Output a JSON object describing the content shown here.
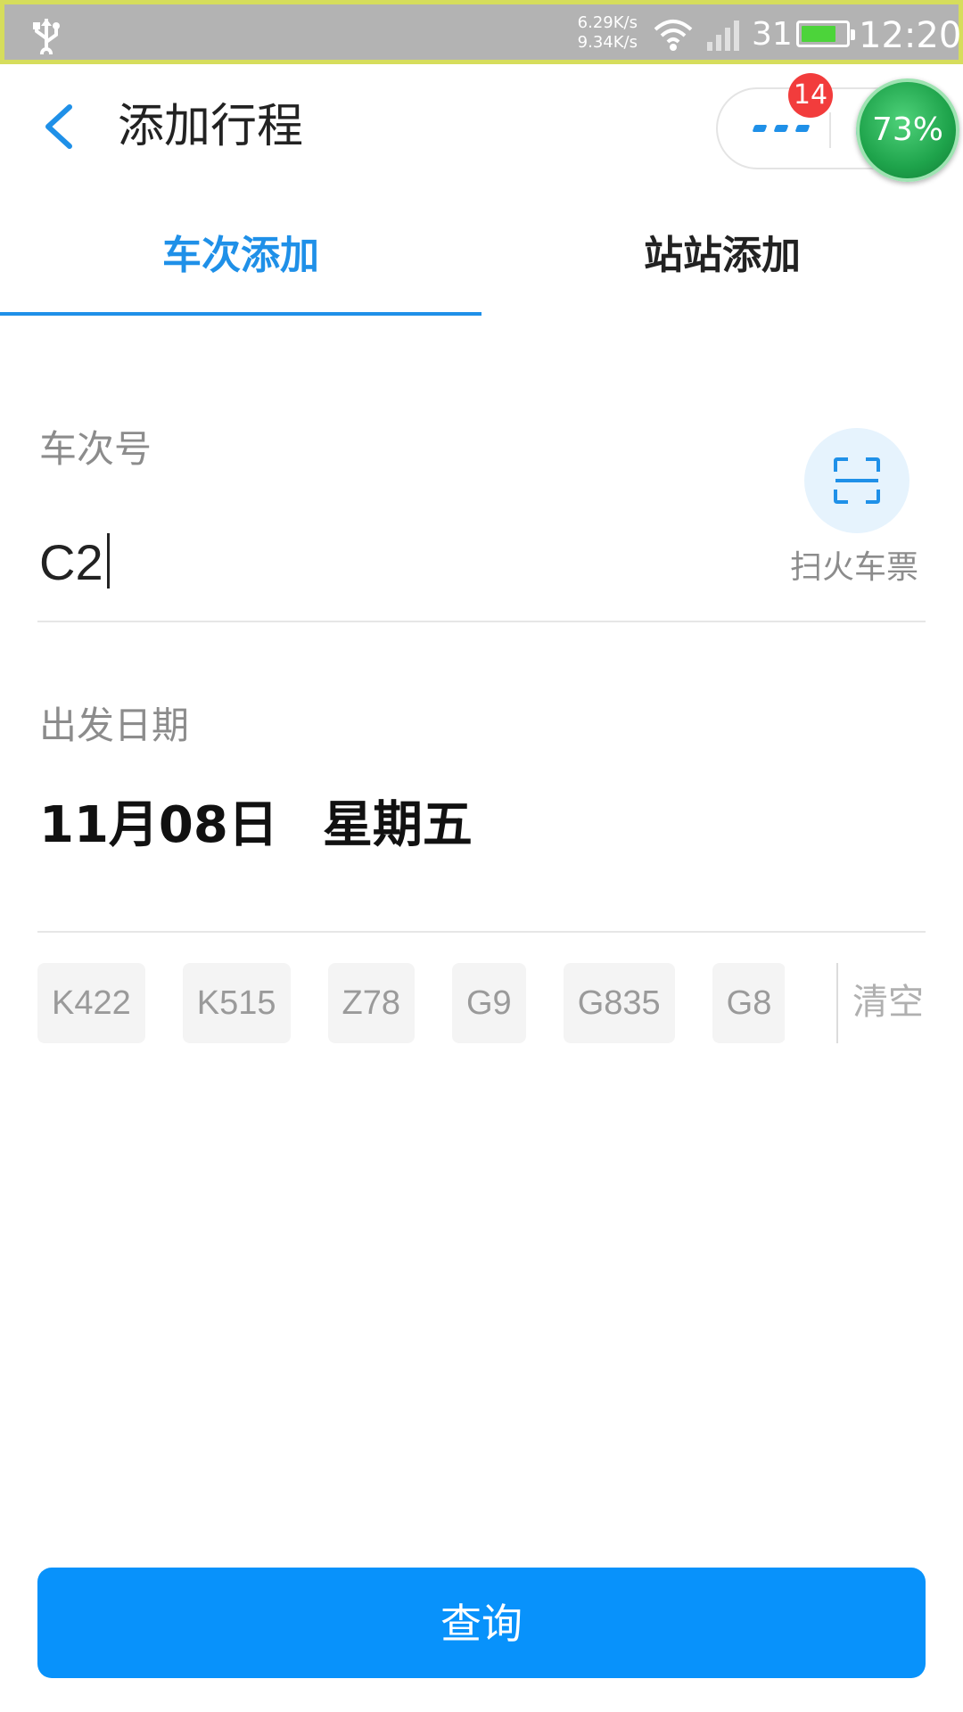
{
  "status_bar": {
    "speed_down": "6.29K/s",
    "speed_up": "9.34K/s",
    "signal_text": "31",
    "battery_level": 0.8,
    "time": "12:20"
  },
  "header": {
    "title": "添加行程",
    "badge_count": "14",
    "float_ball_text": "73%"
  },
  "tabs": [
    {
      "label": "车次添加",
      "active": true
    },
    {
      "label": "站站添加",
      "active": false
    }
  ],
  "form": {
    "train_label": "车次号",
    "train_value": "C2",
    "scan_label": "扫火车票",
    "date_label": "出发日期",
    "date_value": "11月08日",
    "weekday_value": "星期五"
  },
  "history": {
    "chips": [
      "K422",
      "K515",
      "Z78",
      "G9",
      "G835",
      "G8"
    ],
    "clear_label": "清空"
  },
  "query_button": "查询",
  "colors": {
    "accent": "#1f90e8",
    "button": "#0892fb",
    "badge": "#f23c3c"
  }
}
